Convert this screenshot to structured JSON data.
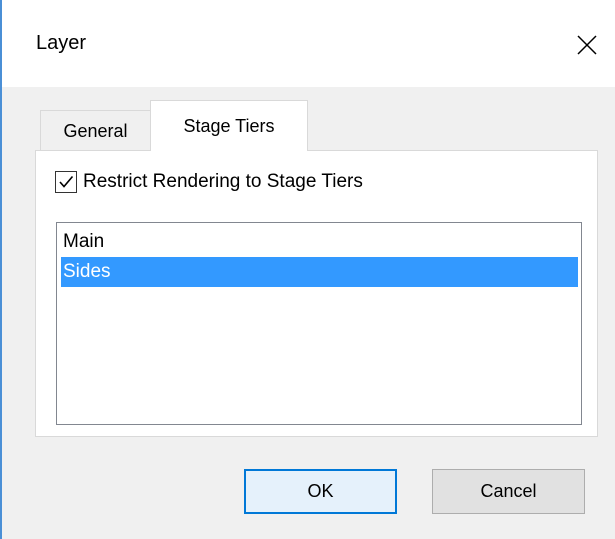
{
  "window": {
    "title": "Layer"
  },
  "tabs": [
    {
      "label": "General",
      "active": false
    },
    {
      "label": "Stage Tiers",
      "active": true
    }
  ],
  "restrict_checkbox": {
    "label": "Restrict Rendering to Stage Tiers",
    "checked": true
  },
  "tiers_list": {
    "items": [
      {
        "label": "Main",
        "selected": false
      },
      {
        "label": "Sides",
        "selected": true
      }
    ]
  },
  "buttons": {
    "ok": "OK",
    "cancel": "Cancel"
  },
  "colors": {
    "selection": "#3399ff",
    "accent": "#0078d7",
    "window_border": "#4a8fd6"
  },
  "icons": {
    "close": "close-icon",
    "check": "checkmark-icon"
  }
}
